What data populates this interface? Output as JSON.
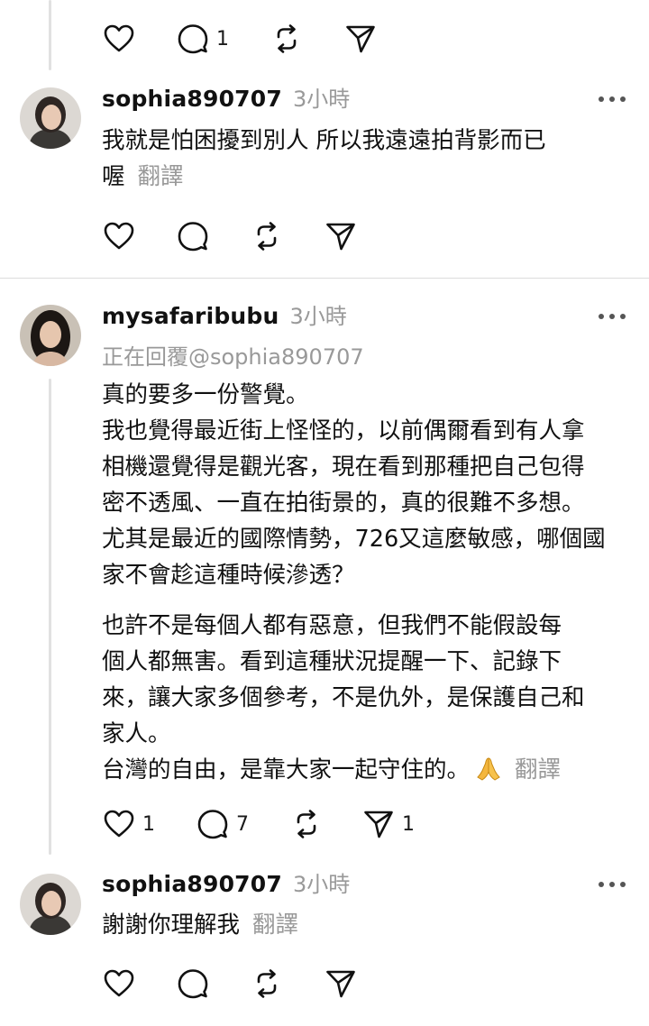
{
  "top_actions": {
    "reply_count": "1"
  },
  "comments": [
    {
      "username": "sophia890707",
      "time": "3小時",
      "lines": [
        "我就是怕困擾到別人 所以我遠遠拍背影而已",
        "喔"
      ],
      "translate": "翻譯"
    },
    {
      "username": "mysafaribubu",
      "time": "3小時",
      "reply_to": "正在回覆@sophia890707",
      "paragraph1": [
        "真的要多一份警覺。",
        "我也覺得最近街上怪怪的，以前偶爾看到有人拿",
        "相機還覺得是觀光客，現在看到那種把自己包得",
        "密不透風、一直在拍街景的，真的很難不多想。",
        "尤其是最近的國際情勢，726又這麼敏感，哪個國",
        "家不會趁這種時候滲透？"
      ],
      "paragraph2": [
        "也許不是每個人都有惡意，但我們不能假設每",
        "個人都無害。看到這種狀況提醒一下、記錄下",
        "來，讓大家多個參考，不是仇外，是保護自己和",
        "家人。",
        "台灣的自由，是靠大家一起守住的。"
      ],
      "emoji": "folded-hands-icon",
      "translate": "翻譯",
      "like_count": "1",
      "reply_count": "7",
      "share_count": "1"
    },
    {
      "username": "sophia890707",
      "time": "3小時",
      "lines": [
        "謝謝你理解我"
      ],
      "translate": "翻譯"
    }
  ],
  "colors": {
    "secondary_text": "#999999",
    "divider": "#dcdcdc",
    "thread_line": "#e1e1e1"
  }
}
